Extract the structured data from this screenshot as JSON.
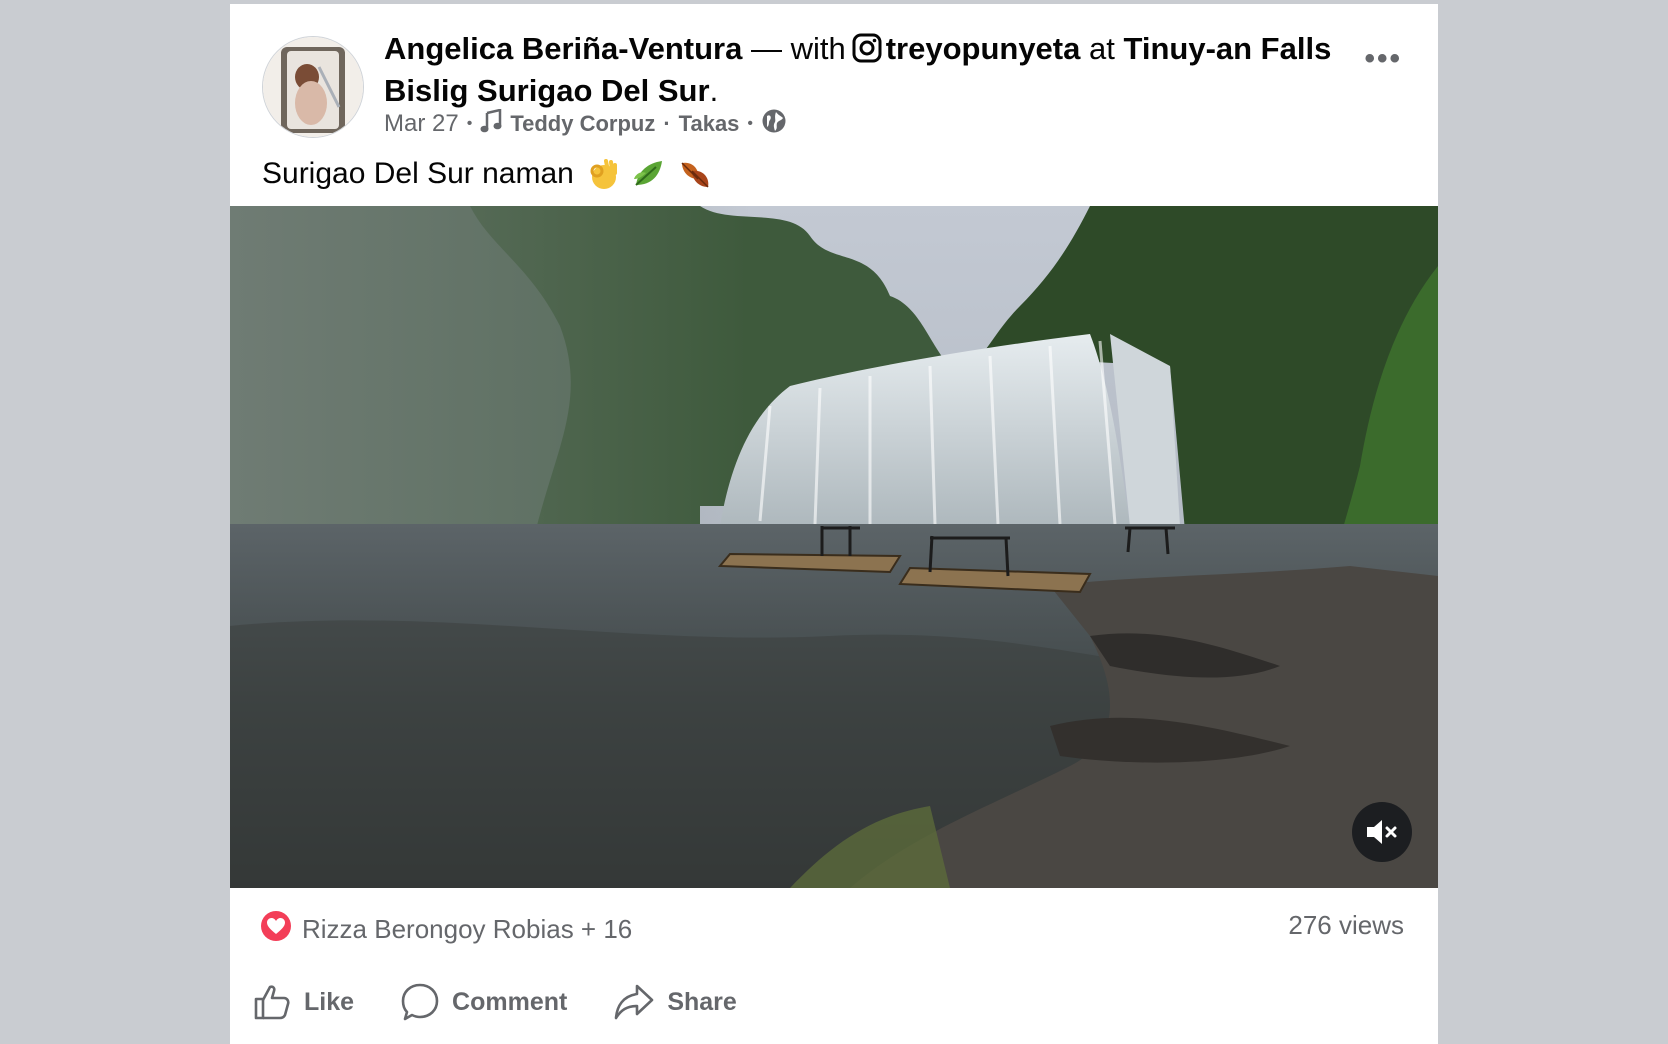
{
  "post": {
    "author": "Angelica Beriña-Ventura",
    "with_text": " — with",
    "tagged": "treyopunyeta",
    "at_text": " at ",
    "place_line1": "Tinuy-an Falls",
    "place_line2": "Bislig Surigao Del Sur",
    "place_suffix": ".",
    "more_label": "•••",
    "date": "Mar 27",
    "song_artist": "Teddy Corpuz",
    "song_sep": "·",
    "song_title": "Takas",
    "caption": "Surigao Del Sur naman",
    "caption_emojis": [
      "ok-hand",
      "leaf",
      "fallen-leaves"
    ]
  },
  "media": {
    "description_icon": "waterfall-video",
    "mute_icon": "speaker-muted-icon"
  },
  "footer": {
    "reactions_text": "Rizza Berongoy Robias + 16",
    "views": "276 views",
    "like_label": "Like",
    "comment_label": "Comment",
    "share_label": "Share"
  },
  "colors": {
    "background": "#c9ccd1",
    "card": "#ffffff",
    "secondary_text": "#65676b",
    "love_red": "#f33e58"
  }
}
